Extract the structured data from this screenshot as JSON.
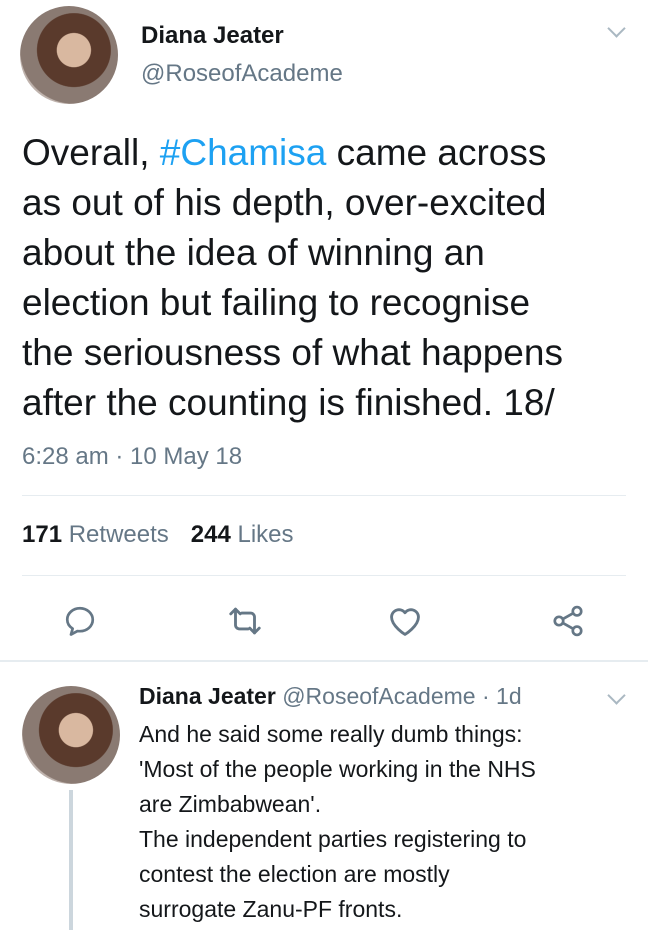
{
  "tweet": {
    "author_name": "Diana Jeater",
    "author_handle": "@RoseofAcademe",
    "text_before_tag": "Overall, ",
    "hashtag": "#Chamisa",
    "text_after_tag": " came across\nas out of his depth, over-excited\nabout the idea of winning an\nelection but failing to recognise\nthe seriousness of what happens\nafter the counting is finished. 18/",
    "timestamp": "6:28 am · 10 May 18",
    "retweets_count": "171",
    "retweets_label": "Retweets",
    "likes_count": "244",
    "likes_label": "Likes",
    "icons": [
      "reply-icon",
      "retweet-icon",
      "like-icon",
      "share-icon"
    ]
  },
  "reply": {
    "author_name": "Diana Jeater",
    "author_handle": "@RoseofAcademe",
    "age": "· 1d",
    "text": "And he said some really dumb things:\n'Most of the people working in the NHS\nare Zimbabwean'.\nThe independent parties registering to\ncontest the election are mostly\nsurrogate Zanu-PF fronts."
  },
  "colors": {
    "link": "#1da1f2",
    "secondary_text": "#657786",
    "primary_text": "#14171a"
  }
}
